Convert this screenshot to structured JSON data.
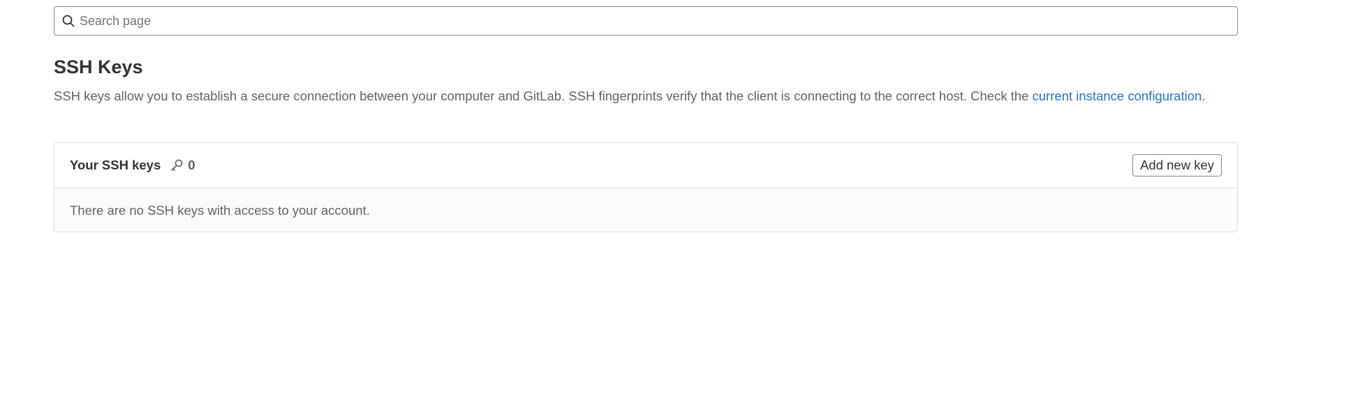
{
  "search": {
    "placeholder": "Search page",
    "value": "",
    "icon": "search-icon"
  },
  "page": {
    "title": "SSH Keys",
    "description": "SSH keys allow you to establish a secure connection between your computer and GitLab. SSH fingerprints verify that the client is connecting to the correct host. Check the ",
    "link_text": "current instance configuration",
    "description_suffix": "."
  },
  "keys_card": {
    "title": "Your SSH keys",
    "count_icon": "key-icon",
    "count": "0",
    "add_button_label": "Add new key",
    "empty_message": "There are no SSH keys with access to your account."
  },
  "colors": {
    "link": "#1f75cb",
    "text": "#333238",
    "muted_text": "#626168",
    "border": "#dcdcde",
    "body_background": "#fbfafd"
  }
}
